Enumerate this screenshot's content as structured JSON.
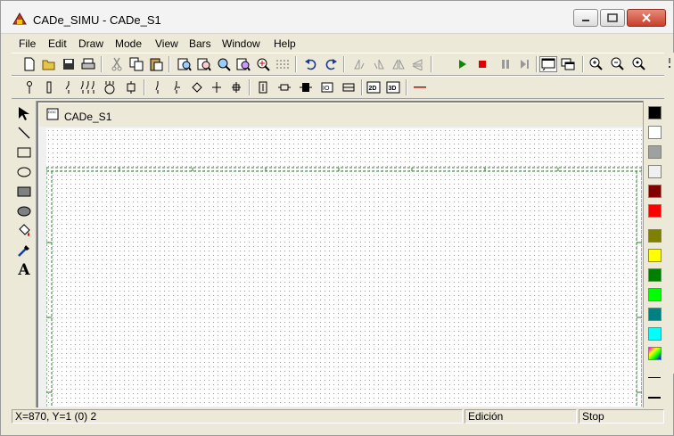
{
  "window": {
    "title": "CADe_SIMU - CADe_S1"
  },
  "menu": [
    "File",
    "Edit",
    "Draw",
    "Mode",
    "View",
    "Bars",
    "Window",
    "Help"
  ],
  "document": {
    "title": "CADe_S1"
  },
  "status": {
    "coords": "X=870, Y=1 (0) 2",
    "mode": "Edición",
    "sim": "Stop"
  },
  "toolbar1": [
    "new-file-icon",
    "open-folder-icon",
    "save-icon",
    "print-icon",
    "cut-icon",
    "copy-icon",
    "paste-icon",
    "zoom-fit-icon",
    "zoom-area-icon",
    "zoom-page-icon",
    "zoom-window-icon",
    "pan-icon",
    "grid-icon",
    "undo-icon",
    "redo-icon",
    "rotate-left-icon",
    "rotate-right-icon",
    "mirror-h-icon",
    "mirror-v-icon",
    "play-icon",
    "stop-icon",
    "pause-icon",
    "step-icon",
    "window-icon",
    "windows-icon",
    "zoom-in-icon",
    "zoom-out-icon",
    "zoom-normal-icon"
  ],
  "toolbar2": [
    "fuse-icon",
    "pushbutton-icon",
    "contact-icon",
    "thermal-icon",
    "motor-icon",
    "relay-icon",
    "switch-icon",
    "switch-nc-icon",
    "diamond-icon",
    "cross-icon",
    "cross2-icon",
    "timer-icon",
    "resistor-icon",
    "coil-icon",
    "io-icon",
    "terminal-icon",
    "view-2d-icon",
    "view-3d-icon",
    "wire-icon"
  ],
  "toolbar2_labels": {
    "view_2d": "2D",
    "view_3d": "3D"
  },
  "lefttools": [
    "select-arrow-icon",
    "line-icon",
    "rectangle-icon",
    "ellipse-icon",
    "filled-rectangle-icon",
    "filled-ellipse-icon",
    "fill-bucket-icon",
    "eyedropper-icon",
    "text-icon"
  ],
  "text_tool_label": "A",
  "palette": [
    "#000000",
    "#ffffff",
    "#a0a0a0",
    "#f0f0f0",
    "#800000",
    "#ff0000",
    "#808000",
    "#ffff00",
    "#008000",
    "#00ff00",
    "#008080",
    "#00ffff"
  ]
}
